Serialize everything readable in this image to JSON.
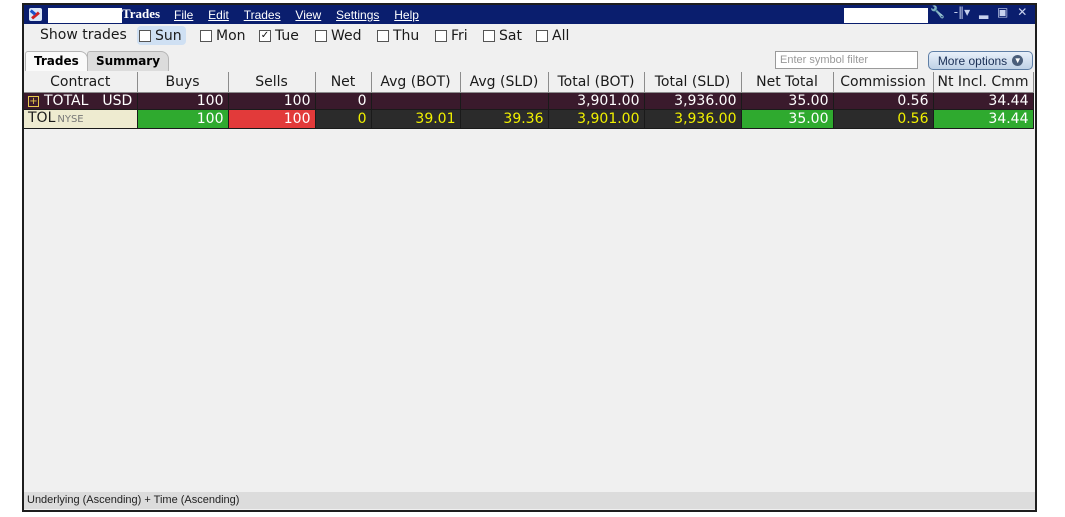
{
  "window": {
    "title": "Trades",
    "menu": [
      "File",
      "Edit",
      "Trades",
      "View",
      "Settings",
      "Help"
    ],
    "controls": [
      "wrench-icon",
      "pin-icon",
      "minimize-icon",
      "maximize-icon",
      "close-icon"
    ]
  },
  "show_trades": {
    "label": "Show trades",
    "days": [
      {
        "label": "Sun",
        "checked": false,
        "focused": true
      },
      {
        "label": "Mon",
        "checked": false
      },
      {
        "label": "Tue",
        "checked": true
      },
      {
        "label": "Wed",
        "checked": false
      },
      {
        "label": "Thu",
        "checked": false
      },
      {
        "label": "Fri",
        "checked": false
      },
      {
        "label": "Sat",
        "checked": false
      },
      {
        "label": "All",
        "checked": false
      }
    ]
  },
  "tabs": [
    {
      "label": "Trades",
      "active": true
    },
    {
      "label": "Summary",
      "active": false
    }
  ],
  "symbol_filter": {
    "placeholder": "Enter symbol filter",
    "value": ""
  },
  "more_options_label": "More options",
  "columns": [
    "Contract",
    "Buys",
    "Sells",
    "Net",
    "Avg (BOT)",
    "Avg (SLD)",
    "Total (BOT)",
    "Total (SLD)",
    "Net Total",
    "Commission",
    "Nt Incl. Cmm"
  ],
  "rows": {
    "total": {
      "contract": "TOTAL",
      "currency": "USD",
      "buys": "100",
      "sells": "100",
      "net": "0",
      "avg_bot": "",
      "avg_sld": "",
      "total_bot": "3,901.00",
      "total_sld": "3,936.00",
      "net_total": "35.00",
      "commission": "0.56",
      "nt_incl_cmm": "34.44"
    },
    "trade": {
      "symbol": "TOL",
      "exchange": "NYSE",
      "buys": "100",
      "sells": "100",
      "net": "0",
      "avg_bot": "39.01",
      "avg_sld": "39.36",
      "total_bot": "3,901.00",
      "total_sld": "3,936.00",
      "net_total": "35.00",
      "commission": "0.56",
      "nt_incl_cmm": "34.44"
    }
  },
  "colors": {
    "title_bar": "#0a1e6e",
    "total_row_bg": "#3a1a2c",
    "trade_row_bg": "#2b2b2b",
    "trade_text": "#f0f000",
    "buy_green": "#2faa2f",
    "sell_red": "#e23a3a"
  },
  "status_bar": "Underlying (Ascending)  + Time (Ascending)"
}
